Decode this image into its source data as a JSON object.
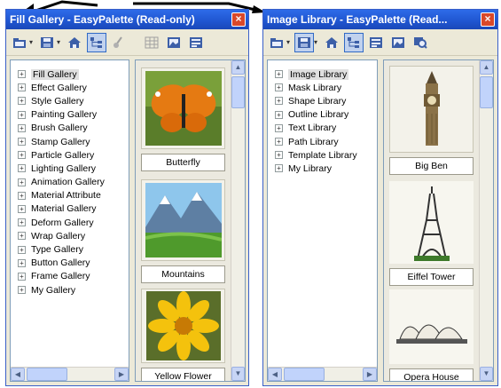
{
  "left_window": {
    "title": "Fill Gallery - EasyPalette (Read-only)",
    "close_label": "×",
    "tree_items": [
      {
        "label": "Fill Gallery",
        "expander": "+"
      },
      {
        "label": "Effect Gallery",
        "expander": "+"
      },
      {
        "label": "Style Gallery",
        "expander": "+"
      },
      {
        "label": "Painting Gallery",
        "expander": "+"
      },
      {
        "label": "Brush Gallery",
        "expander": "+"
      },
      {
        "label": "Stamp Gallery",
        "expander": "+"
      },
      {
        "label": "Particle Gallery",
        "expander": "+"
      },
      {
        "label": "Lighting Gallery",
        "expander": "+"
      },
      {
        "label": "Animation Gallery",
        "expander": "+"
      },
      {
        "label": "Material Attribute",
        "expander": "+"
      },
      {
        "label": "Material Gallery",
        "expander": "+"
      },
      {
        "label": "Deform Gallery",
        "expander": "+"
      },
      {
        "label": "Wrap Gallery",
        "expander": "+"
      },
      {
        "label": "Type Gallery",
        "expander": "+"
      },
      {
        "label": "Button Gallery",
        "expander": "+"
      },
      {
        "label": "Frame Gallery",
        "expander": "+"
      },
      {
        "label": "My Gallery",
        "expander": "+"
      }
    ],
    "gallery_items": [
      {
        "caption": "Butterfly",
        "icon": "butterfly-thumbnail"
      },
      {
        "caption": "Mountains",
        "icon": "mountains-thumbnail"
      },
      {
        "caption": "Yellow Flower",
        "icon": "yellow-flower-thumbnail"
      }
    ]
  },
  "right_window": {
    "title": "Image Library - EasyPalette (Read...",
    "close_label": "×",
    "tree_items": [
      {
        "label": "Image Library",
        "expander": "+"
      },
      {
        "label": "Mask Library",
        "expander": "+"
      },
      {
        "label": "Shape Library",
        "expander": "+"
      },
      {
        "label": "Outline Library",
        "expander": "+"
      },
      {
        "label": "Text Library",
        "expander": "+"
      },
      {
        "label": "Path Library",
        "expander": "+"
      },
      {
        "label": "Template Library",
        "expander": "+"
      },
      {
        "label": "My Library",
        "expander": "+"
      }
    ],
    "gallery_items": [
      {
        "caption": "Big Ben",
        "icon": "big-ben-thumbnail"
      },
      {
        "caption": "Eiffel Tower",
        "icon": "eiffel-tower-thumbnail"
      },
      {
        "caption": "Opera House",
        "icon": "opera-house-thumbnail"
      }
    ]
  },
  "scroll_glyphs": {
    "up": "▲",
    "down": "▼",
    "left": "◀",
    "right": "▶"
  },
  "toolbar_dropdown_glyph": "▾",
  "colors": {
    "titlebar": "#1f55d0",
    "close": "#d9482a",
    "window": "#ece9d8"
  }
}
